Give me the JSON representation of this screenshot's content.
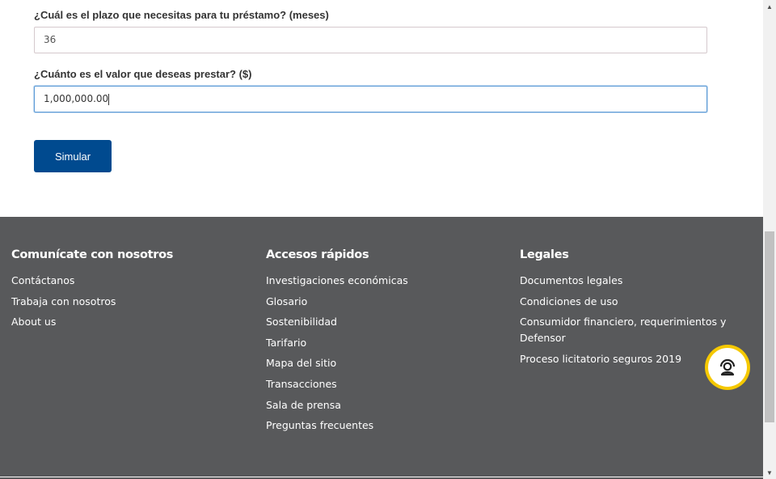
{
  "form": {
    "term_label": "¿Cuál es el plazo que necesitas para tu préstamo? (meses)",
    "term_value": "36",
    "amount_label": "¿Cuánto es el valor que deseas prestar? ($)",
    "amount_value": "1,000,000.00",
    "submit_label": "Simular"
  },
  "footer": {
    "columns": [
      {
        "title": "Comunícate con nosotros",
        "links": [
          "Contáctanos",
          "Trabaja con nosotros",
          "About us"
        ]
      },
      {
        "title": "Accesos rápidos",
        "links": [
          "Investigaciones económicas",
          "Glosario",
          "Sostenibilidad",
          "Tarifario",
          "Mapa del sitio",
          "Transacciones",
          "Sala de prensa",
          "Preguntas frecuentes"
        ]
      },
      {
        "title": "Legales",
        "links": [
          "Documentos legales",
          "Condiciones de uso",
          "Consumidor financiero, requerimientos y Defensor",
          "Proceso licitatorio seguros 2019"
        ]
      }
    ]
  },
  "chat": {
    "icon": "chat-agent-icon",
    "accent_color": "#f5c800"
  },
  "colors": {
    "footer_bg": "#58595b",
    "button_bg": "#004a8f",
    "focus_border": "#5b9ad6"
  }
}
